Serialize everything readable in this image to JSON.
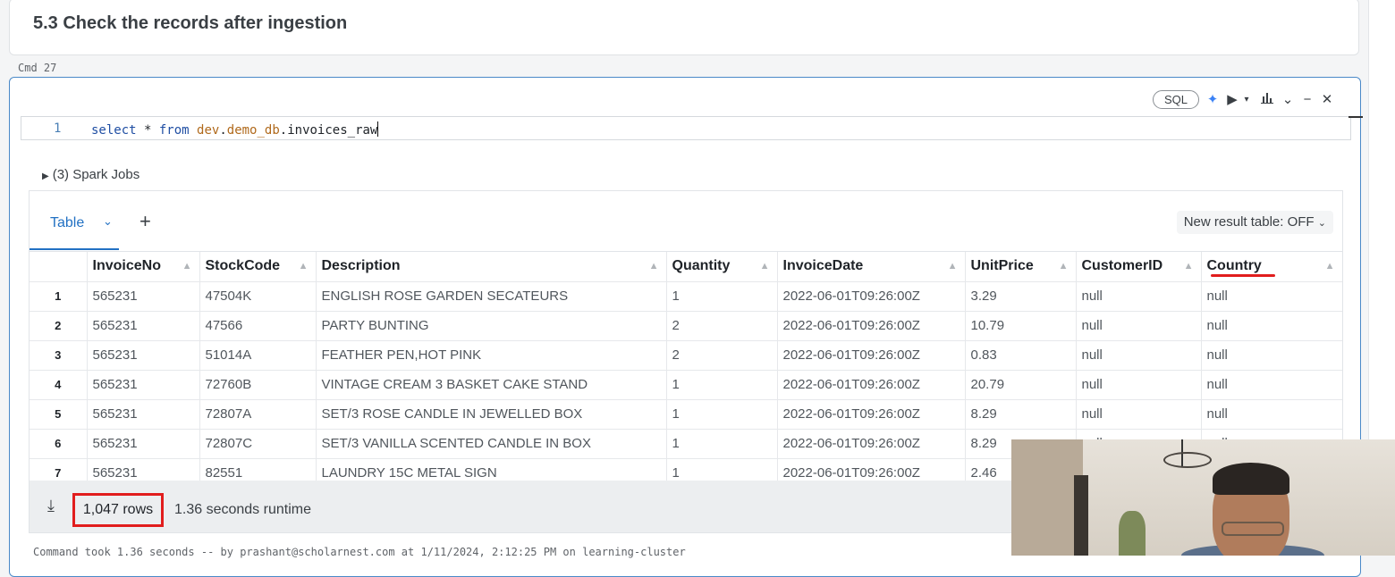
{
  "markdown": {
    "heading": "5.3 Check the records after ingestion"
  },
  "cmd_label": "Cmd 27",
  "toolbar": {
    "language": "SQL",
    "icons": [
      "sparkle-icon",
      "run-icon",
      "dropdown-icon",
      "chart-icon",
      "chevron-down-icon",
      "minimize-icon",
      "close-icon"
    ]
  },
  "editor": {
    "line_number": "1",
    "tokens": {
      "kw_select": "select",
      "star": " * ",
      "kw_from": "from",
      "space": " ",
      "db": "dev",
      "dot1": ".",
      "schema": "demo_db",
      "dot2": ".",
      "table": "invoices_raw"
    }
  },
  "spark_jobs": "(3) Spark Jobs",
  "results": {
    "tab_label": "Table",
    "new_result_toggle": "New result table: OFF",
    "columns": [
      "InvoiceNo",
      "StockCode",
      "Description",
      "Quantity",
      "InvoiceDate",
      "UnitPrice",
      "CustomerID",
      "Country"
    ],
    "rows": [
      [
        "1",
        "565231",
        "47504K",
        "ENGLISH ROSE GARDEN SECATEURS",
        "1",
        "2022-06-01T09:26:00Z",
        "3.29",
        "null",
        "null"
      ],
      [
        "2",
        "565231",
        "47566",
        "PARTY BUNTING",
        "2",
        "2022-06-01T09:26:00Z",
        "10.79",
        "null",
        "null"
      ],
      [
        "3",
        "565231",
        "51014A",
        "FEATHER PEN,HOT PINK",
        "2",
        "2022-06-01T09:26:00Z",
        "0.83",
        "null",
        "null"
      ],
      [
        "4",
        "565231",
        "72760B",
        "VINTAGE CREAM 3 BASKET CAKE STAND",
        "1",
        "2022-06-01T09:26:00Z",
        "20.79",
        "null",
        "null"
      ],
      [
        "5",
        "565231",
        "72807A",
        "SET/3 ROSE CANDLE IN JEWELLED BOX",
        "1",
        "2022-06-01T09:26:00Z",
        "8.29",
        "null",
        "null"
      ],
      [
        "6",
        "565231",
        "72807C",
        "SET/3 VANILLA SCENTED CANDLE IN BOX",
        "1",
        "2022-06-01T09:26:00Z",
        "8.29",
        "null",
        "null"
      ],
      [
        "7",
        "565231",
        "82551",
        "LAUNDRY 15C METAL SIGN",
        "1",
        "2022-06-01T09:26:00Z",
        "2.46",
        "null",
        "null"
      ]
    ],
    "row_count": "1,047 rows",
    "runtime": "1.36 seconds runtime"
  },
  "command_took": "Command took 1.36 seconds -- by prashant@scholarnest.com at 1/11/2024, 2:12:25 PM on learning-cluster",
  "colors": {
    "accent": "#2271c3",
    "highlight": "#e11d1d",
    "cell_border": "#4a89c8"
  }
}
